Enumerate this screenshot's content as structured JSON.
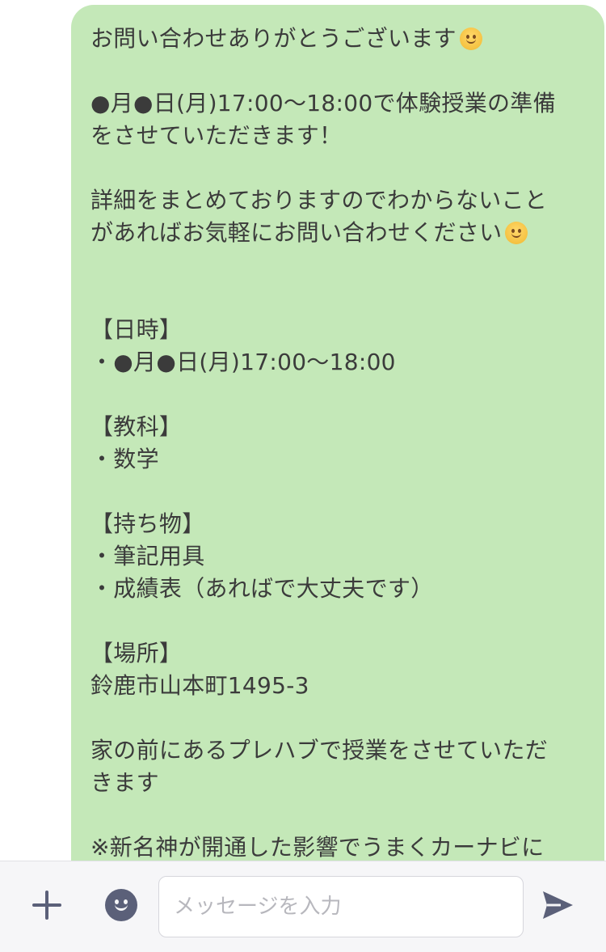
{
  "message": {
    "lines": [
      "お問い合わせありがとうございます",
      "",
      "●月●日(月)17:00〜18:00で体験授業の準備",
      "をさせていただきます！",
      "",
      "詳細をまとめておりますのでわからないこと",
      "があればお気軽にお問い合わせください",
      "",
      "",
      " 【日時】",
      "・●月●日(月)17:00〜18:00",
      "",
      " 【教科】",
      "・数学",
      "",
      " 【持ち物】",
      "・筆記用具",
      "・成績表（あればで大丈夫です）",
      "",
      " 【場所】",
      "鈴鹿市山本町1495-3",
      "",
      "家の前にあるプレハブで授業をさせていただ",
      "きます",
      "",
      "※新名神が開通した影響でうまくカーナビに"
    ],
    "emoji_icon": "slightly-smiling-face"
  },
  "footer": {
    "input_placeholder": "メッセージを入力",
    "input_value": "",
    "plus_icon": "plus-icon",
    "sticker_icon": "smiley-icon",
    "send_icon": "send-icon",
    "icon_color": "#5b6079"
  },
  "colors": {
    "bubble": "#c4e8b8",
    "text": "#3b3b3b",
    "footer_bg": "#f6f6f8"
  }
}
